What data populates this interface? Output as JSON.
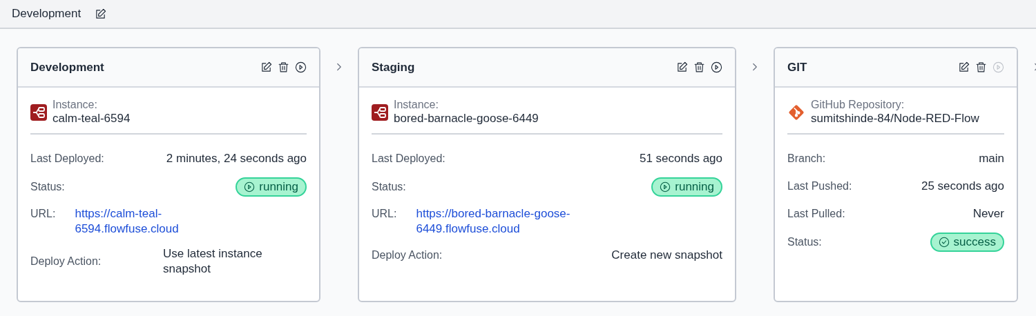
{
  "header": {
    "title": "Development"
  },
  "stages": [
    {
      "title": "Development",
      "run_disabled": false,
      "source": {
        "kind": "instance",
        "label": "Instance:",
        "value": "calm-teal-6594"
      },
      "rows": [
        {
          "kind": "text",
          "label": "Last Deployed:",
          "value": "2 minutes, 24 seconds ago"
        },
        {
          "kind": "status",
          "label": "Status:",
          "value": "running"
        },
        {
          "kind": "link",
          "label": "URL:",
          "value": "https://calm-teal-6594.flowfuse.cloud"
        },
        {
          "kind": "text",
          "label": "Deploy Action:",
          "value": "Use latest instance snapshot"
        }
      ]
    },
    {
      "title": "Staging",
      "run_disabled": false,
      "source": {
        "kind": "instance",
        "label": "Instance:",
        "value": "bored-barnacle-goose-6449"
      },
      "rows": [
        {
          "kind": "text",
          "label": "Last Deployed:",
          "value": "51 seconds ago"
        },
        {
          "kind": "status",
          "label": "Status:",
          "value": "running"
        },
        {
          "kind": "link",
          "label": "URL:",
          "value": "https://bored-barnacle-goose-6449.flowfuse.cloud"
        },
        {
          "kind": "text",
          "label": "Deploy Action:",
          "value": "Create new snapshot"
        }
      ]
    },
    {
      "title": "GIT",
      "run_disabled": true,
      "source": {
        "kind": "repository",
        "label": "GitHub Repository:",
        "value": "sumitshinde-84/Node-RED-Flow"
      },
      "rows": [
        {
          "kind": "text",
          "label": "Branch:",
          "value": "main"
        },
        {
          "kind": "text",
          "label": "Last Pushed:",
          "value": "25 seconds ago"
        },
        {
          "kind": "text",
          "label": "Last Pulled:",
          "value": "Never"
        },
        {
          "kind": "status",
          "label": "Status:",
          "value": "success"
        }
      ]
    }
  ]
}
